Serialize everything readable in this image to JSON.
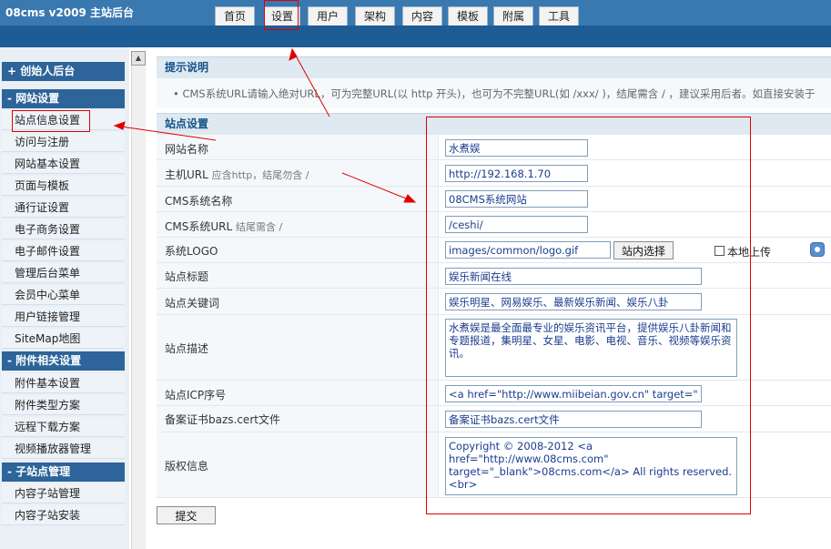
{
  "app": {
    "title": "08cms  v2009  主站后台"
  },
  "topnav": [
    "首页",
    "设置",
    "用户",
    "架构",
    "内容",
    "模板",
    "附属",
    "工具"
  ],
  "sidebar": {
    "sections": [
      {
        "title": "+  创始人后台",
        "items": []
      },
      {
        "title": "-  网站设置",
        "items": [
          "站点信息设置",
          "访问与注册",
          "网站基本设置",
          "页面与模板",
          "通行证设置",
          "电子商务设置",
          "电子邮件设置",
          "管理后台菜单",
          "会员中心菜单",
          "用户链接管理",
          "SiteMap地图"
        ]
      },
      {
        "title": "-  附件相关设置",
        "items": [
          "附件基本设置",
          "附件类型方案",
          "远程下载方案",
          "视频播放器管理"
        ]
      },
      {
        "title": "-  子站点管理",
        "items": [
          "内容子站管理",
          "内容子站安装"
        ]
      }
    ]
  },
  "tips": {
    "title": "提示说明",
    "text": "CMS系统URL请输入绝对URL，可为完整URL(以 http 开头)，也可为不完整URL(如 /xxx/ )，结尾需含 / ，建议采用后者。如直接安装于"
  },
  "form": {
    "title": "站点设置",
    "fields": {
      "site_name": {
        "label": "网站名称",
        "value": "水煮娱"
      },
      "host_url": {
        "label": "主机URL",
        "hint": "应含http，结尾勿含 /",
        "value": "http://192.168.1.70"
      },
      "cms_name": {
        "label": "CMS系统名称",
        "value": "08CMS系统网站"
      },
      "cms_url": {
        "label": "CMS系统URL",
        "hint": "结尾需含 /",
        "value": "/ceshi/"
      },
      "logo": {
        "label": "系统LOGO",
        "value": "images/common/logo.gif",
        "select_button": "站内选择",
        "local_upload": "本地上传"
      },
      "site_title": {
        "label": "站点标题",
        "value": "娱乐新闻在线"
      },
      "keywords": {
        "label": "站点关键词",
        "value": "娱乐明星、网易娱乐、最新娱乐新闻、娱乐八卦"
      },
      "description": {
        "label": "站点描述",
        "value": "水煮娱是最全面最专业的娱乐资讯平台，提供娱乐八卦新闻和专题报道，集明星、女星、电影、电视、音乐、视频等娱乐资讯。"
      },
      "icp": {
        "label": "站点ICP序号",
        "value": "<a href=\"http://www.miibeian.gov.cn\" target=\"_blank\">"
      },
      "bazs_cert": {
        "label": "备案证书bazs.cert文件",
        "value": "备案证书bazs.cert文件"
      },
      "copyright": {
        "label": "版权信息",
        "value": "Copyright © 2008-2012 <a href=\"http://www.08cms.com\" target=\"_blank\">08cms.com</a> All rights reserved.<br>"
      }
    },
    "submit_label": "提交"
  },
  "colors": {
    "header": "#1e5c95",
    "sidebar_head": "#2d6499",
    "annotation": "#e00000"
  }
}
